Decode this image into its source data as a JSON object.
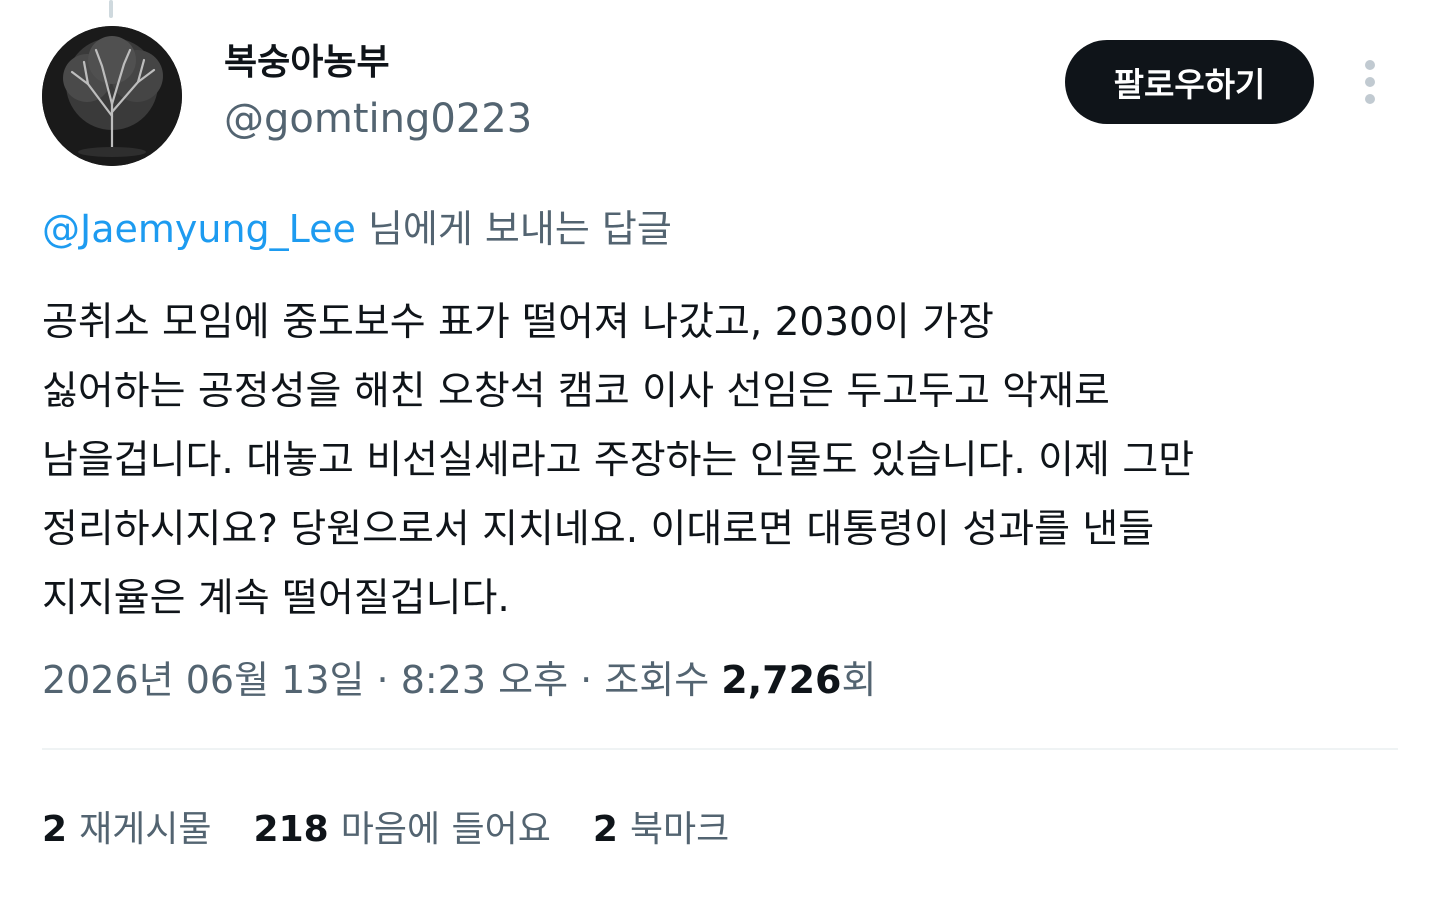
{
  "author": {
    "display_name": "복숭아농부",
    "handle": "@gomting0223",
    "avatar_icon": "tree-avatar-icon"
  },
  "actions": {
    "follow_label": "팔로우하기",
    "more_icon": "more-vertical-icon"
  },
  "reply": {
    "mention": "@Jaemyung_Lee",
    "suffix": "님에게 보내는 답글"
  },
  "tweet": {
    "lines": [
      "공취소 모임에 중도보수 표가 떨어져 나갔고, 2030이 가장",
      "싫어하는 공정성을 해친 오창석 캠코 이사 선임은 두고두고 악재로",
      "남을겁니다. 대놓고 비선실세라고 주장하는 인물도 있습니다. 이제 그만",
      "정리하시지요? 당원으로서 지치네요. 이대로면 대통령이 성과를 낸들",
      "지지율은 계속 떨어질겁니다."
    ]
  },
  "meta": {
    "date": "2026년 06월 13일",
    "sep1": " · ",
    "time": "8:23 오후",
    "sep2": " · ",
    "views_label": "조회수",
    "views_count": "2,726",
    "views_suffix": "회"
  },
  "stats": {
    "reposts_count": "2",
    "reposts_label": "재게시물",
    "likes_count": "218",
    "likes_label": "마음에 들어요",
    "bookmarks_count": "2",
    "bookmarks_label": "북마크"
  },
  "colors": {
    "accent": "#1d9bf0",
    "text_primary": "#0f1419",
    "text_secondary": "#536471",
    "button_bg": "#0f1419",
    "divider": "#eff3f4"
  }
}
